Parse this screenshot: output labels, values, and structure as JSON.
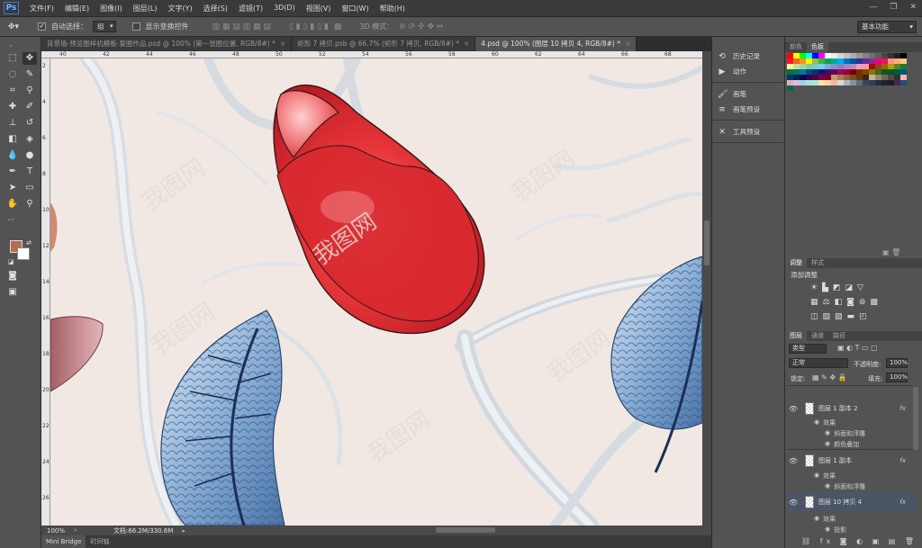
{
  "app": {
    "logo": "Ps",
    "menu": [
      "文件(F)",
      "编辑(E)",
      "图像(I)",
      "图层(L)",
      "文字(Y)",
      "选择(S)",
      "滤镜(T)",
      "3D(D)",
      "视图(V)",
      "窗口(W)",
      "帮助(H)"
    ]
  },
  "options": {
    "auto_select_label": "自动选择：",
    "auto_select_value": "组",
    "show_transform_label": "显示变换控件",
    "mode3d_label": "3D 模式：",
    "workspace": "基本功能"
  },
  "tabs": [
    {
      "title": "背景墙-预览图样机模板-爱图作品.psd @ 100% (第一张图位置, RGB/8#) *"
    },
    {
      "title": "矩形 7 拷贝.psb @ 66.7% (矩形 7 拷贝, RGB/8#) *"
    },
    {
      "title": "4.psd @ 100% (图层 10 拷贝 4, RGB/8#) *"
    }
  ],
  "ruler_top": [
    "40",
    "42",
    "44",
    "46",
    "48",
    "50",
    "52",
    "54",
    "56",
    "58",
    "60",
    "62",
    "64",
    "66",
    "68"
  ],
  "ruler_left": [
    "2",
    "4",
    "6",
    "8",
    "10",
    "12",
    "14",
    "16",
    "18",
    "20",
    "22",
    "24",
    "26"
  ],
  "status": {
    "zoom": "100%",
    "doc": "文档:66.2M/330.6M"
  },
  "bottom_tabs": [
    "Mini Bridge",
    "时间轴"
  ],
  "collapsed_panels": [
    {
      "icon": "history-icon",
      "glyph": "⟲",
      "label": "历史记录"
    },
    {
      "icon": "actions-icon",
      "glyph": "▶",
      "label": "动作"
    },
    {
      "icon": "brush-icon",
      "glyph": "🖌",
      "label": "画笔"
    },
    {
      "icon": "brush-presets-icon",
      "glyph": "≡",
      "label": "画笔预设"
    },
    {
      "icon": "tool-presets-icon",
      "glyph": "✕",
      "label": "工具预设"
    }
  ],
  "color_panel": {
    "tabs": [
      "颜色",
      "色板"
    ]
  },
  "swatch_colors": [
    "#ff0000",
    "#ffff00",
    "#00ff00",
    "#00ffff",
    "#0000ff",
    "#ff00ff",
    "#ffffff",
    "#ebebeb",
    "#d6d6d6",
    "#c2c2c2",
    "#adadad",
    "#999999",
    "#858585",
    "#707070",
    "#5c5c5c",
    "#474747",
    "#333333",
    "#1f1f1f",
    "#000000",
    "#ed1c24",
    "#f26522",
    "#f7941d",
    "#fff200",
    "#8dc63f",
    "#39b54a",
    "#00a651",
    "#00a99d",
    "#00aeef",
    "#0072bc",
    "#0054a6",
    "#2e3192",
    "#662d91",
    "#92278f",
    "#ec008c",
    "#ed145b",
    "#f7977a",
    "#f9ad81",
    "#fdc689",
    "#fff799",
    "#c4df9b",
    "#a3d39c",
    "#82ca9d",
    "#7accc8",
    "#6dcff6",
    "#7da7d9",
    "#8393ca",
    "#8781bd",
    "#a187be",
    "#bd8cbf",
    "#f49ac2",
    "#f6989d",
    "#9e0b0f",
    "#a0410d",
    "#a3620a",
    "#aba000",
    "#598527",
    "#197b30",
    "#007236",
    "#00746b",
    "#0076a3",
    "#004b80",
    "#003471",
    "#1b1464",
    "#440e62",
    "#630460",
    "#9e005d",
    "#9e0039",
    "#790000",
    "#7b2e00",
    "#7d4900",
    "#827b00",
    "#406618",
    "#005e20",
    "#005826",
    "#005952",
    "#005b7f",
    "#003663",
    "#002157",
    "#0d004c",
    "#32004b",
    "#4b0049",
    "#7b0046",
    "#7a0026",
    "#c69c6d",
    "#a67c52",
    "#8c6239",
    "#754c24",
    "#603913",
    "#3c2415",
    "#c7b299",
    "#998675",
    "#736357",
    "#534741",
    "#362f2d",
    "#f5b7b1",
    "#e6b0aa",
    "#d7bde2",
    "#a9cce3",
    "#a3e4d7",
    "#abebc6",
    "#f9e79f",
    "#fad7a0",
    "#edbb99",
    "#d5dbdb",
    "#aeb6bf",
    "#85929e",
    "#5d6d7e",
    "#34495e",
    "#2e4053",
    "#212f3d",
    "#1b2631",
    "#17202a",
    "#4a235a",
    "#1a5276",
    "#0e6251"
  ],
  "adjustments": {
    "tabs": [
      "调整",
      "样式"
    ],
    "title": "添加调整"
  },
  "layers": {
    "tabs": [
      "图层",
      "通道",
      "路径"
    ],
    "kind": "类型",
    "blend": "正常",
    "opacity_label": "不透明度:",
    "opacity": "100%",
    "lock_label": "锁定:",
    "fill_label": "填充:",
    "fill": "100%",
    "items": [
      {
        "name": "图层 1 副本 2",
        "effects": [
          "效果",
          "斜面和浮雕",
          "颜色叠加"
        ]
      },
      {
        "name": "图层 1 副本",
        "effects": [
          "效果",
          "斜面和浮雕"
        ]
      },
      {
        "name": "图层 10 拷贝 4",
        "effects": [
          "效果",
          "投影"
        ]
      }
    ],
    "fx": "fx"
  }
}
